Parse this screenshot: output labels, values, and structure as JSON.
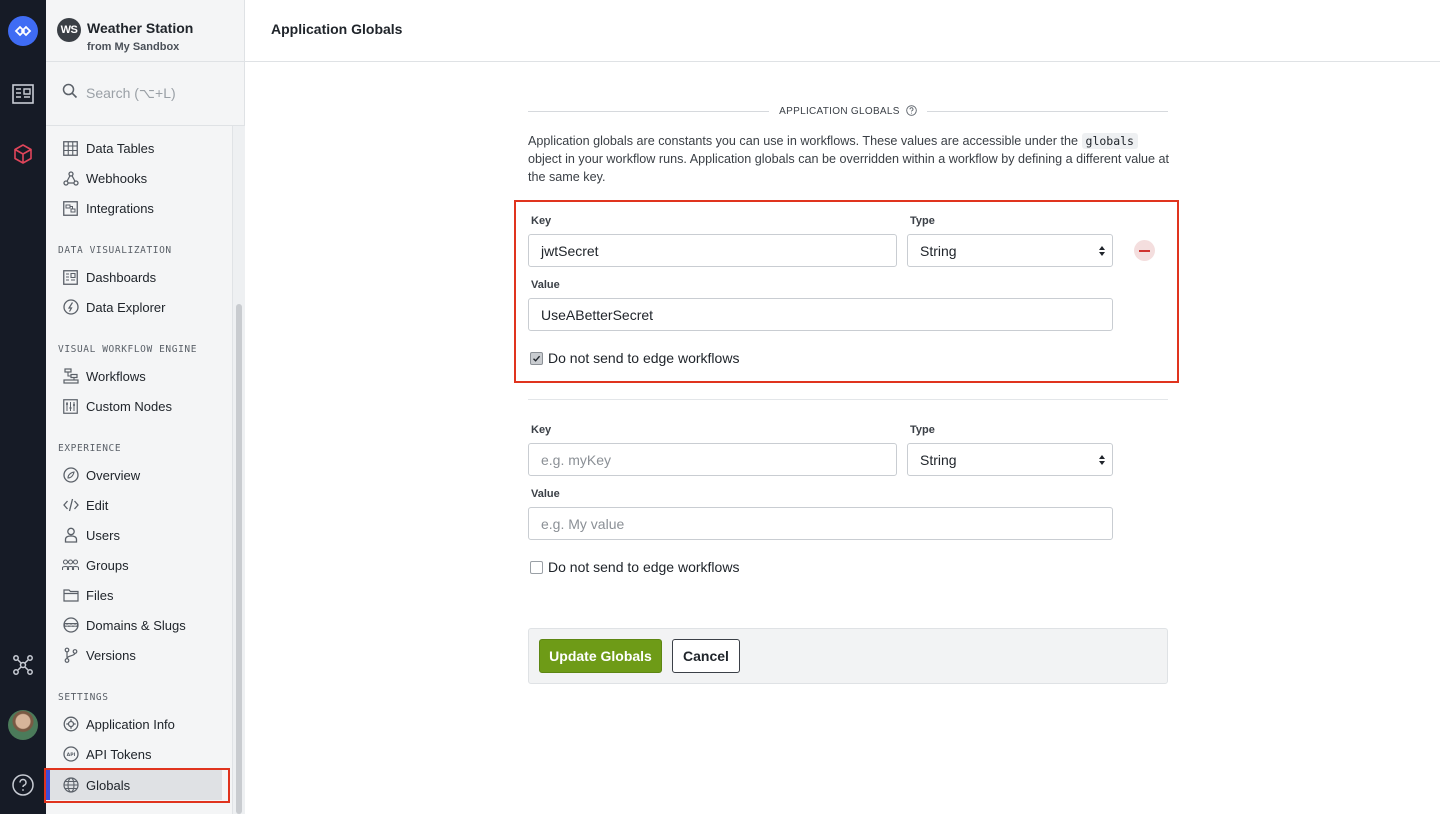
{
  "app": {
    "badge": "WS",
    "name": "Weather Station",
    "subtitle": "from My Sandbox"
  },
  "search": {
    "label": "Search (⌥+L)"
  },
  "sidebar": {
    "items_top": [
      {
        "label": "Data Tables",
        "icon": "table-icon"
      },
      {
        "label": "Webhooks",
        "icon": "webhook-icon"
      },
      {
        "label": "Integrations",
        "icon": "integrations-icon"
      }
    ],
    "sections": [
      {
        "title": "DATA VISUALIZATION",
        "items": [
          {
            "label": "Dashboards",
            "icon": "dashboard-icon"
          },
          {
            "label": "Data Explorer",
            "icon": "explorer-icon"
          }
        ]
      },
      {
        "title": "VISUAL WORKFLOW ENGINE",
        "items": [
          {
            "label": "Workflows",
            "icon": "workflow-icon"
          },
          {
            "label": "Custom Nodes",
            "icon": "sliders-icon"
          }
        ]
      },
      {
        "title": "EXPERIENCE",
        "items": [
          {
            "label": "Overview",
            "icon": "overview-icon"
          },
          {
            "label": "Edit",
            "icon": "code-icon"
          },
          {
            "label": "Users",
            "icon": "user-icon"
          },
          {
            "label": "Groups",
            "icon": "group-icon"
          },
          {
            "label": "Files",
            "icon": "folder-icon"
          },
          {
            "label": "Domains & Slugs",
            "icon": "www-icon"
          },
          {
            "label": "Versions",
            "icon": "branch-icon"
          }
        ]
      },
      {
        "title": "SETTINGS",
        "items": [
          {
            "label": "Application Info",
            "icon": "gear-icon"
          },
          {
            "label": "API Tokens",
            "icon": "api-icon"
          },
          {
            "label": "Globals",
            "icon": "globe-icon"
          }
        ]
      }
    ]
  },
  "header": {
    "title": "Application Globals"
  },
  "main": {
    "section_title": "APPLICATION GLOBALS",
    "desc_part1": "Application globals are constants you can use in workflows. These values are accessible under the ",
    "desc_code": "globals",
    "desc_part2": " object in your workflow runs. Application globals can be overridden within a workflow by defining a different value at the same key.",
    "entries": [
      {
        "key_label": "Key",
        "key_value": "jwtSecret",
        "type_label": "Type",
        "type_value": "String",
        "value_label": "Value",
        "value_value": "UseABetterSecret",
        "edge_checked": true,
        "edge_label": "Do not send to edge workflows"
      },
      {
        "key_label": "Key",
        "key_placeholder": "e.g. myKey",
        "type_label": "Type",
        "type_value": "String",
        "value_label": "Value",
        "value_placeholder": "e.g. My value",
        "edge_checked": false,
        "edge_label": "Do not send to edge workflows"
      }
    ],
    "update_label": "Update Globals",
    "cancel_label": "Cancel"
  },
  "colors": {
    "rail": "#161b26",
    "accent_blue": "#3f6cf4",
    "primary_green": "#6e9b17",
    "highlight_red": "#e0341e",
    "remove_red": "#d0332f"
  }
}
